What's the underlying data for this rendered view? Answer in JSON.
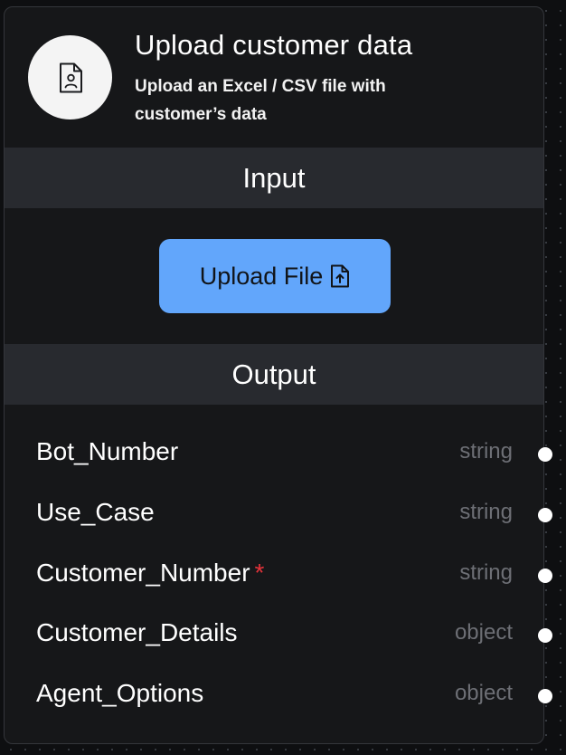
{
  "node": {
    "title": "Upload customer data",
    "subtitle": "Upload an Excel / CSV file with customer’s data",
    "icon": "file-user-icon"
  },
  "input_section": {
    "label": "Input",
    "upload_button": {
      "label": "Upload File",
      "icon": "file-upload-icon",
      "color": "#62a6fb"
    }
  },
  "output_section": {
    "label": "Output",
    "fields": [
      {
        "name": "Bot_Number",
        "type": "string",
        "required": false
      },
      {
        "name": "Use_Case",
        "type": "string",
        "required": false
      },
      {
        "name": "Customer_Number",
        "type": "string",
        "required": true,
        "required_marker": "*"
      },
      {
        "name": "Customer_Details",
        "type": "object",
        "required": false
      },
      {
        "name": "Agent_Options",
        "type": "object",
        "required": false
      }
    ]
  },
  "colors": {
    "canvas": "#0e0f11",
    "node_bg": "#161719",
    "section_bar": "#282a2f",
    "accent_button": "#62a6fb",
    "required": "#e5333a",
    "type_text": "#6d6f75"
  }
}
